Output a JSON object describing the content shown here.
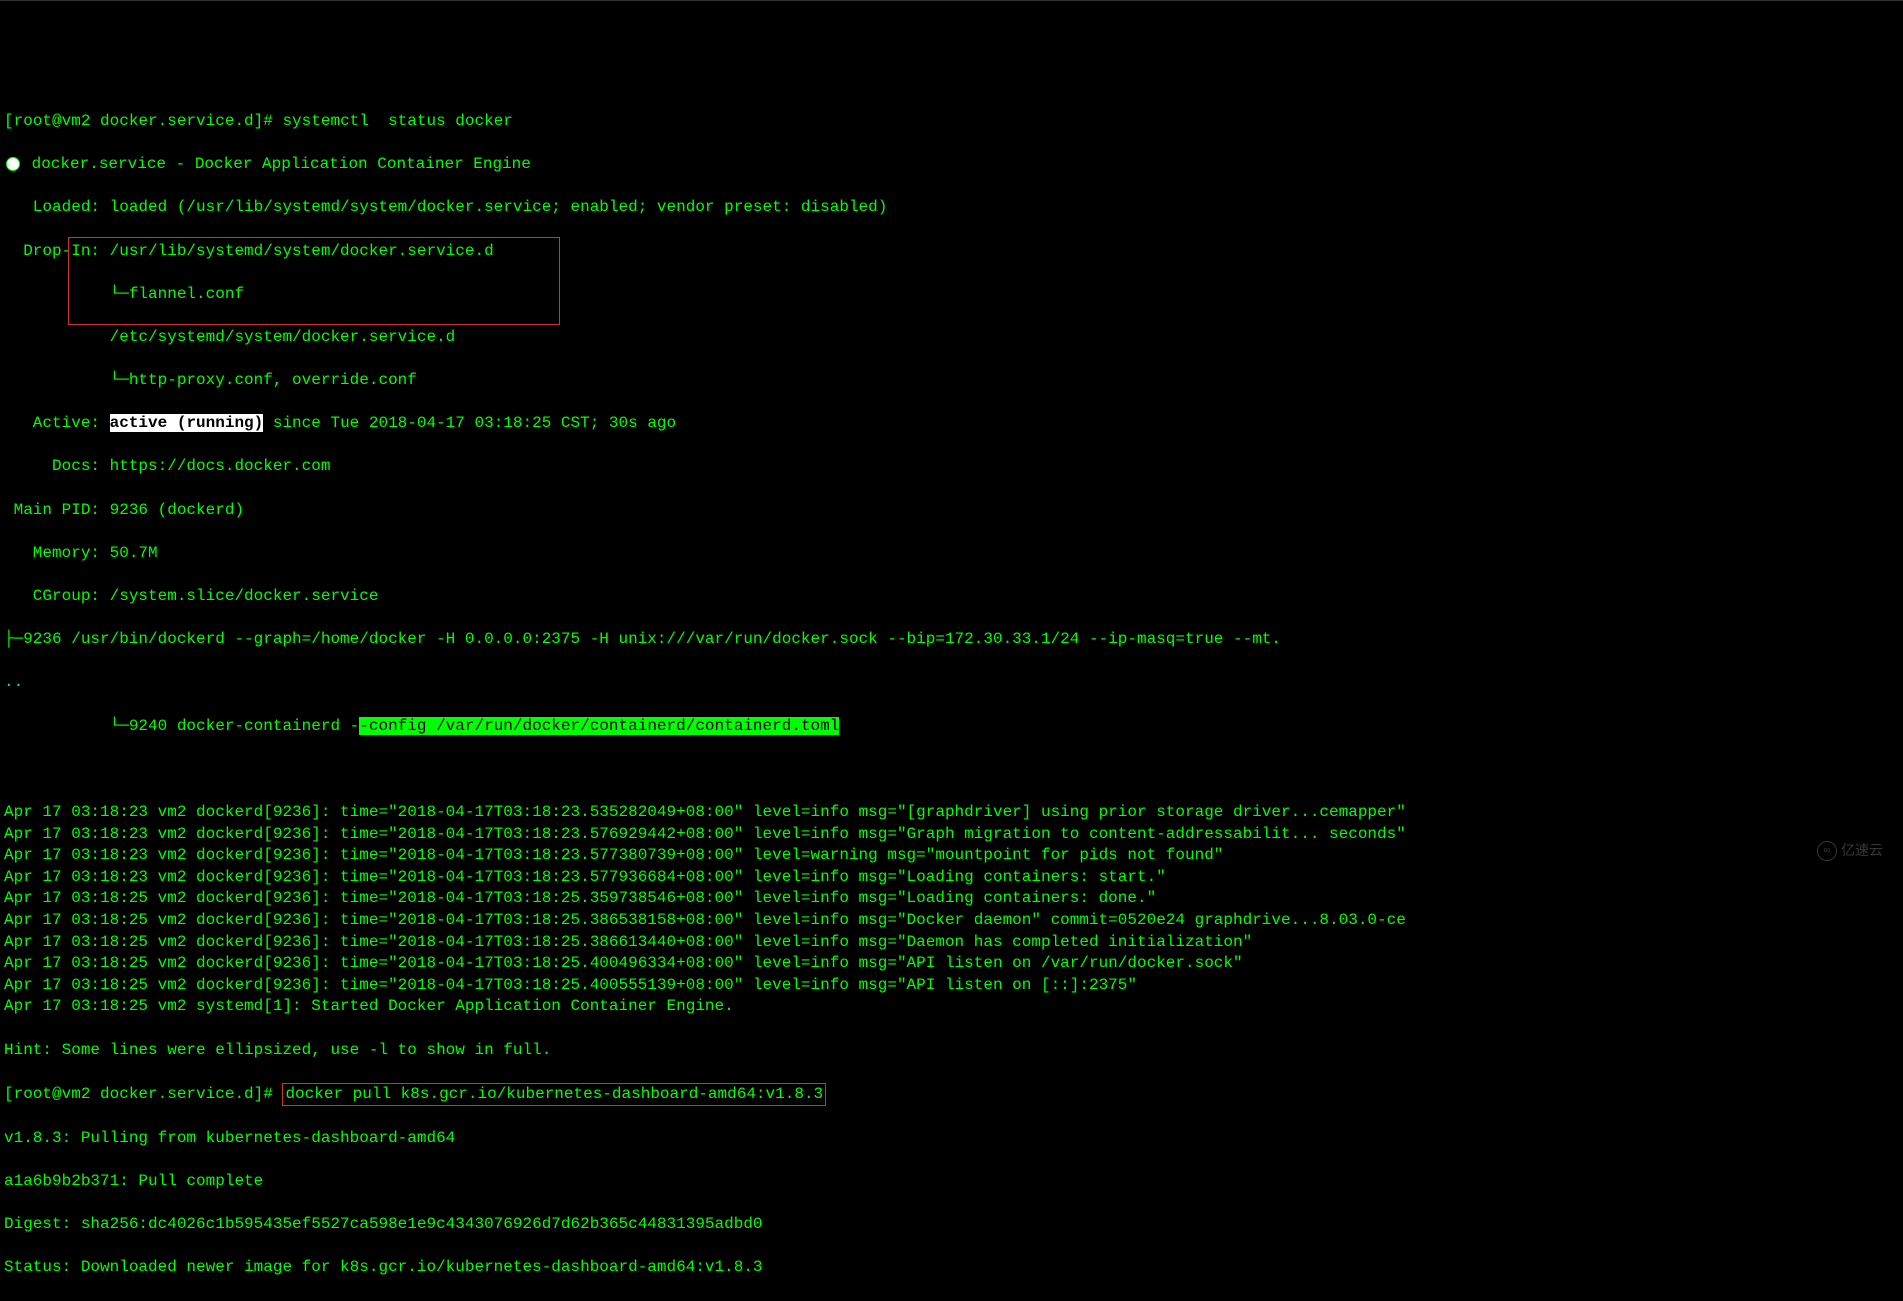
{
  "prompt1": "[root@vm2 docker.service.d]# ",
  "cmd1": "systemctl  status docker",
  "bullet_line": " docker.service - Docker Application Container Engine",
  "loaded": "   Loaded: loaded (/usr/lib/systemd/system/docker.service; enabled; vendor preset: disabled)",
  "dropin1": "  Drop-In: /usr/lib/systemd/system/docker.service.d",
  "dropin2": "           └─flannel.conf",
  "dropin3": "           /etc/systemd/system/docker.service.d",
  "dropin4": "           └─http-proxy.conf, override.conf",
  "active_prefix": "   Active: ",
  "active_hl": "active (running)",
  "active_suffix": " since Tue 2018-04-17 03:18:25 CST; 30s ago",
  "docs": "     Docs: https://docs.docker.com",
  "mainpid": " Main PID: 9236 (dockerd)",
  "memory": "   Memory: 50.7M",
  "cgroup": "   CGroup: /system.slice/docker.service",
  "cgroup_l1": "           ├─9236 /usr/bin/dockerd --graph=/home/docker -H 0.0.0.0:2375 -H unix:///var/run/docker.sock --bip=172.30.33.1/24 --ip-masq=true --mt.",
  "cgroup_dots": "..",
  "cgroup_l2_prefix": "           └─9240 docker-containerd -",
  "cgroup_l2_hl": "-config /var/run/docker/containerd/containerd.toml",
  "logs": [
    "Apr 17 03:18:23 vm2 dockerd[9236]: time=\"2018-04-17T03:18:23.535282049+08:00\" level=info msg=\"[graphdriver] using prior storage driver...cemapper\"",
    "Apr 17 03:18:23 vm2 dockerd[9236]: time=\"2018-04-17T03:18:23.576929442+08:00\" level=info msg=\"Graph migration to content-addressabilit... seconds\"",
    "Apr 17 03:18:23 vm2 dockerd[9236]: time=\"2018-04-17T03:18:23.577380739+08:00\" level=warning msg=\"mountpoint for pids not found\"",
    "Apr 17 03:18:23 vm2 dockerd[9236]: time=\"2018-04-17T03:18:23.577936684+08:00\" level=info msg=\"Loading containers: start.\"",
    "Apr 17 03:18:25 vm2 dockerd[9236]: time=\"2018-04-17T03:18:25.359738546+08:00\" level=info msg=\"Loading containers: done.\"",
    "Apr 17 03:18:25 vm2 dockerd[9236]: time=\"2018-04-17T03:18:25.386538158+08:00\" level=info msg=\"Docker daemon\" commit=0520e24 graphdrive...8.03.0-ce",
    "Apr 17 03:18:25 vm2 dockerd[9236]: time=\"2018-04-17T03:18:25.386613440+08:00\" level=info msg=\"Daemon has completed initialization\"",
    "Apr 17 03:18:25 vm2 dockerd[9236]: time=\"2018-04-17T03:18:25.400496334+08:00\" level=info msg=\"API listen on /var/run/docker.sock\"",
    "Apr 17 03:18:25 vm2 dockerd[9236]: time=\"2018-04-17T03:18:25.400555139+08:00\" level=info msg=\"API listen on [::]:2375\"",
    "Apr 17 03:18:25 vm2 systemd[1]: Started Docker Application Container Engine."
  ],
  "hint": "Hint: Some lines were ellipsized, use -l to show in full.",
  "prompt2": "[root@vm2 docker.service.d]# ",
  "cmd2": "docker pull k8s.gcr.io/kubernetes-dashboard-amd64:v1.8.3",
  "pull1": "v1.8.3: Pulling from kubernetes-dashboard-amd64",
  "pull2": "a1a6b9b2b371: Pull complete",
  "pull3": "Digest: sha256:dc4026c1b595435ef5527ca598e1e9c4343076926d7d62b365c44831395adbd0",
  "pull4": "Status: Downloaded newer image for k8s.gcr.io/kubernetes-dashboard-amd64:v1.8.3",
  "watermark": "亿速云"
}
